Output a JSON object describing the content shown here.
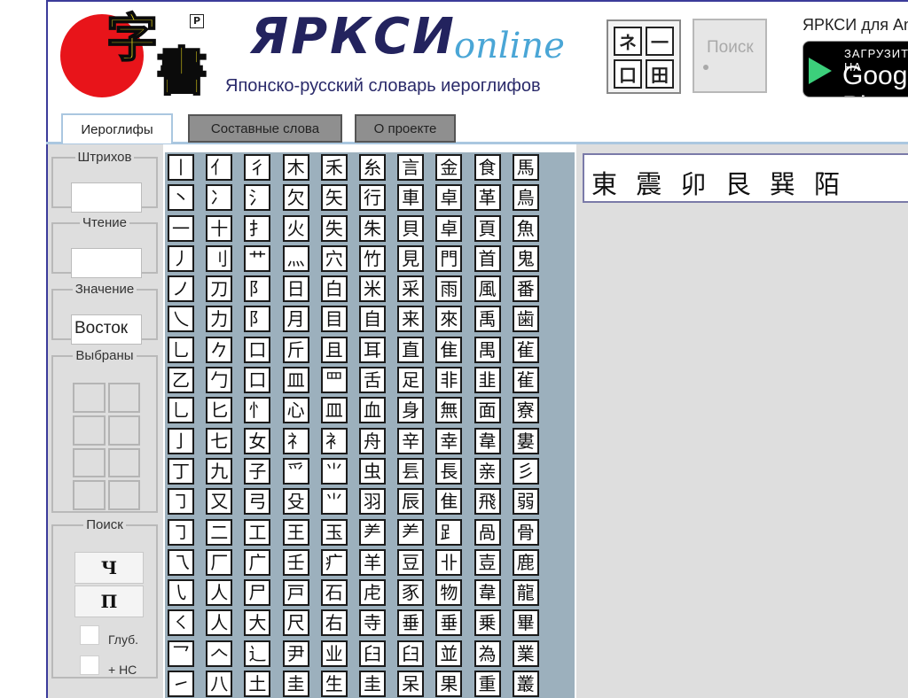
{
  "header": {
    "logo_kanji_1": "字",
    "logo_kanji_2": "書",
    "logo_mark": "P",
    "title": "ЯРКСИ",
    "title_suffix": "online",
    "subtitle": "Японско-русский словарь иероглифов",
    "kanji_input_button": [
      "ネ",
      "一",
      "口",
      "田"
    ],
    "search_button_label": "Поиск",
    "promo_text": "ЯРКСИ для Android",
    "gplay_small": "ЗАГРУЗИТЕ НА",
    "gplay_big": "Google Play"
  },
  "tabs": [
    {
      "label": "Иероглифы",
      "active": true
    },
    {
      "label": "Составные слова",
      "active": false
    },
    {
      "label": "О проекте",
      "active": false
    }
  ],
  "left_panel": {
    "strokes_legend": "Штрихов",
    "strokes_value": "",
    "reading_legend": "Чтение",
    "reading_value": "",
    "meaning_legend": "Значение",
    "meaning_value": "Восток",
    "selected_legend": "Выбраны",
    "search_legend": "Поиск",
    "search_button_1": "Ч",
    "search_button_2": "П",
    "checkbox_deep_label": "Глуб.",
    "checkbox_ns_label": "+ НС"
  },
  "radicals": [
    [
      "丨",
      "亻",
      "彳",
      "木",
      "禾",
      "糸",
      "言",
      "金",
      "食",
      "馬"
    ],
    [
      "丶",
      "冫",
      "氵",
      "欠",
      "矢",
      "行",
      "車",
      "卓",
      "革",
      "鳥"
    ],
    [
      "一",
      "十",
      "扌",
      "火",
      "失",
      "朱",
      "貝",
      "卓",
      "頁",
      "魚"
    ],
    [
      "丿",
      "刂",
      "艹",
      "灬",
      "穴",
      "竹",
      "見",
      "門",
      "首",
      "鬼"
    ],
    [
      "ノ",
      "刀",
      "阝",
      "日",
      "白",
      "米",
      "采",
      "雨",
      "風",
      "番"
    ],
    [
      "乀",
      "力",
      "阝",
      "月",
      "目",
      "自",
      "来",
      "來",
      "禹",
      "歯"
    ],
    [
      "乚",
      "𠂊",
      "口",
      "斤",
      "且",
      "耳",
      "直",
      "隹",
      "禺",
      "雈"
    ],
    [
      "乙",
      "勹",
      "口",
      "皿",
      "罒",
      "舌",
      "足",
      "非",
      "韭",
      "雈"
    ],
    [
      "乚",
      "匕",
      "忄",
      "心",
      "皿",
      "血",
      "身",
      "無",
      "面",
      "寮"
    ],
    [
      "亅",
      "七",
      "女",
      "礻",
      "衤",
      "舟",
      "辛",
      "幸",
      "韋",
      "婁"
    ],
    [
      "丁",
      "九",
      "子",
      "爫",
      "⺌",
      "虫",
      "镸",
      "長",
      "亲",
      "彡"
    ],
    [
      "㇆",
      "又",
      "弓",
      "殳",
      "⺌",
      "羽",
      "辰",
      "隹",
      "飛",
      "弱"
    ],
    [
      "㇆",
      "二",
      "工",
      "王",
      "玉",
      "⺶",
      "⺶",
      "⻊",
      "咼",
      "骨"
    ],
    [
      "乁",
      "厂",
      "广",
      "壬",
      "疒",
      "羊",
      "豆",
      "卝",
      "壴",
      "鹿"
    ],
    [
      "㇂",
      "人",
      "尸",
      "戸",
      "石",
      "虍",
      "豕",
      "物",
      "韋",
      "龍"
    ],
    [
      "㇛",
      "人",
      "大",
      "尺",
      "右",
      "寺",
      "垂",
      "垂",
      "乗",
      "畢"
    ],
    [
      "乛",
      "𠆢",
      "辶",
      "尹",
      "业",
      "臼",
      "臼",
      "並",
      "為",
      "業"
    ],
    [
      "㇀",
      "八",
      "土",
      "圭",
      "生",
      "圭",
      "呆",
      "果",
      "重",
      "叢"
    ]
  ],
  "results": {
    "kanji": "東 震 卯 艮 巽 陌"
  }
}
